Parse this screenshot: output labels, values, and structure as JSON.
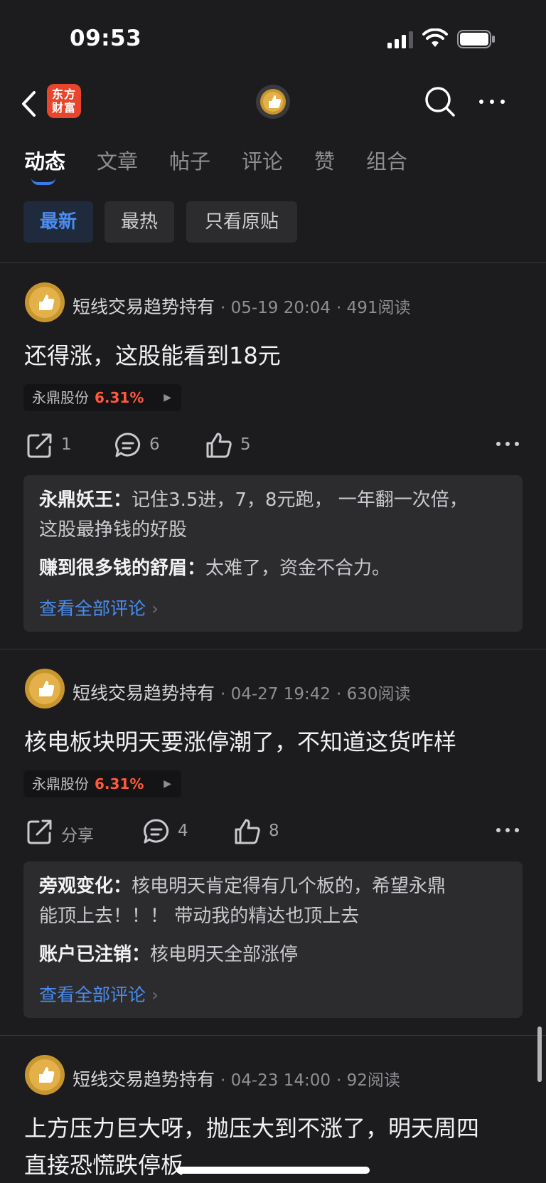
{
  "status": {
    "time": "09:53"
  },
  "header": {
    "logo_line1": "东方",
    "logo_line2": "财富"
  },
  "tabs": [
    {
      "label": "动态"
    },
    {
      "label": "文章"
    },
    {
      "label": "帖子"
    },
    {
      "label": "评论"
    },
    {
      "label": "赞"
    },
    {
      "label": "组合"
    }
  ],
  "filters": [
    {
      "label": "最新"
    },
    {
      "label": "最热"
    },
    {
      "label": "只看原贴"
    }
  ],
  "posts": [
    {
      "author": "短线交易趋势持有",
      "date": "05-19 20:04",
      "reads": "491阅读",
      "text": [
        "还得涨，这股能看到18元"
      ],
      "stock": {
        "name": "永鼎股份",
        "change": "6.31%"
      },
      "share": "1",
      "comments_count": "6",
      "likes": "5",
      "comments": [
        {
          "user": "永鼎妖王",
          "sep": "：",
          "text": "记住3.5进，7，8元跑， 一年翻一次倍，",
          "text2": "这股最挣钱的好股"
        },
        {
          "user": "赚到很多钱的舒眉",
          "sep": "：",
          "text": "太难了，资金不合力。"
        }
      ],
      "view_all": "查看全部评论"
    },
    {
      "author": "短线交易趋势持有",
      "date": "04-27 19:42",
      "reads": "630阅读",
      "text": [
        "核电板块明天要涨停潮了，不知道这货咋样"
      ],
      "stock": {
        "name": "永鼎股份",
        "change": "6.31%"
      },
      "share": "分享",
      "comments_count": "4",
      "likes": "8",
      "comments": [
        {
          "user": "旁观变化",
          "sep": "：",
          "text": "核电明天肯定得有几个板的，希望永鼎",
          "text2": "能顶上去！！！ 带动我的精达也顶上去"
        },
        {
          "user": "账户已注销",
          "sep": "：",
          "text": "核电明天全部涨停"
        }
      ],
      "view_all": "查看全部评论"
    },
    {
      "author": "短线交易趋势持有",
      "date": "04-23 14:00",
      "reads": "92阅读",
      "text": [
        "上方压力巨大呀，抛压大到不涨了，明天周四",
        "直接恐慌跌停板"
      ]
    }
  ],
  "colors": {
    "accent": "#4a8cf0",
    "up": "#ff5a3c",
    "brand": "#e8462c"
  }
}
